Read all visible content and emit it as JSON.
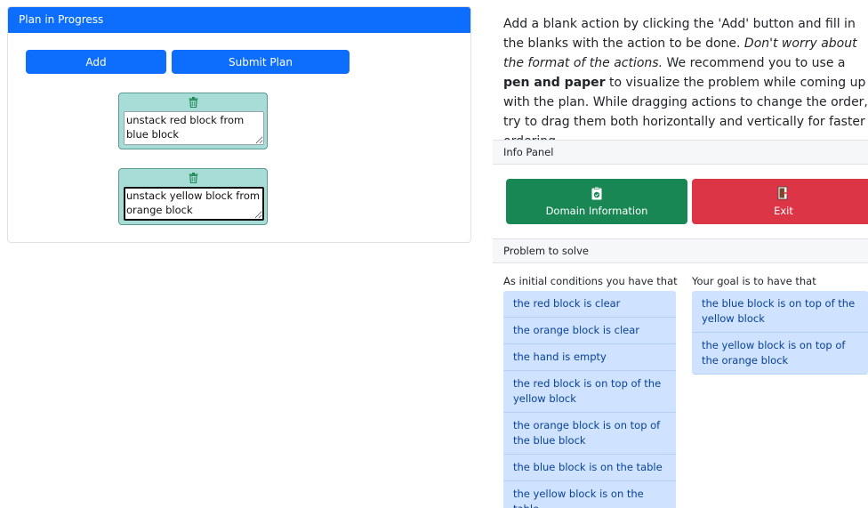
{
  "plan": {
    "header": "Plan in Progress",
    "add_label": "Add",
    "submit_label": "Submit Plan",
    "actions": [
      {
        "text": "unstack red block from blue block"
      },
      {
        "text": "unstack yellow block from orange block"
      }
    ]
  },
  "instructions": {
    "part1": "Add a blank action by clicking the 'Add' button and fill in the blanks with the action to be done. ",
    "italic": "Don't worry about the format of the actions.",
    "part2": " We recommend you to use a ",
    "bold": "pen and paper",
    "part3": " to visualize the problem while coming up with the plan. While dragging actions to change the order, try to drag them both horizontally and vertically for faster ordering."
  },
  "info_panel": {
    "header": "Info Panel",
    "domain_label": "Domain Information",
    "exit_label": "Exit"
  },
  "problem": {
    "header": "Problem to solve",
    "initial_label": "As initial conditions you have that",
    "goal_label": "Your goal is to have that",
    "initial": [
      "the red block is clear",
      "the orange block is clear",
      "the hand is empty",
      "the red block is on top of the yellow block",
      "the orange block is on top of the blue block",
      "the blue block is on the table",
      "the yellow block is on the table"
    ],
    "goals": [
      "the blue block is on top of the yellow block",
      "the yellow block is on top of the orange block"
    ]
  },
  "colors": {
    "primary": "#0d6efd",
    "success": "#198754",
    "danger": "#dc3545",
    "action_card": "#a8dcd6",
    "list_bg": "#cfe2ff",
    "list_text": "#084298"
  }
}
